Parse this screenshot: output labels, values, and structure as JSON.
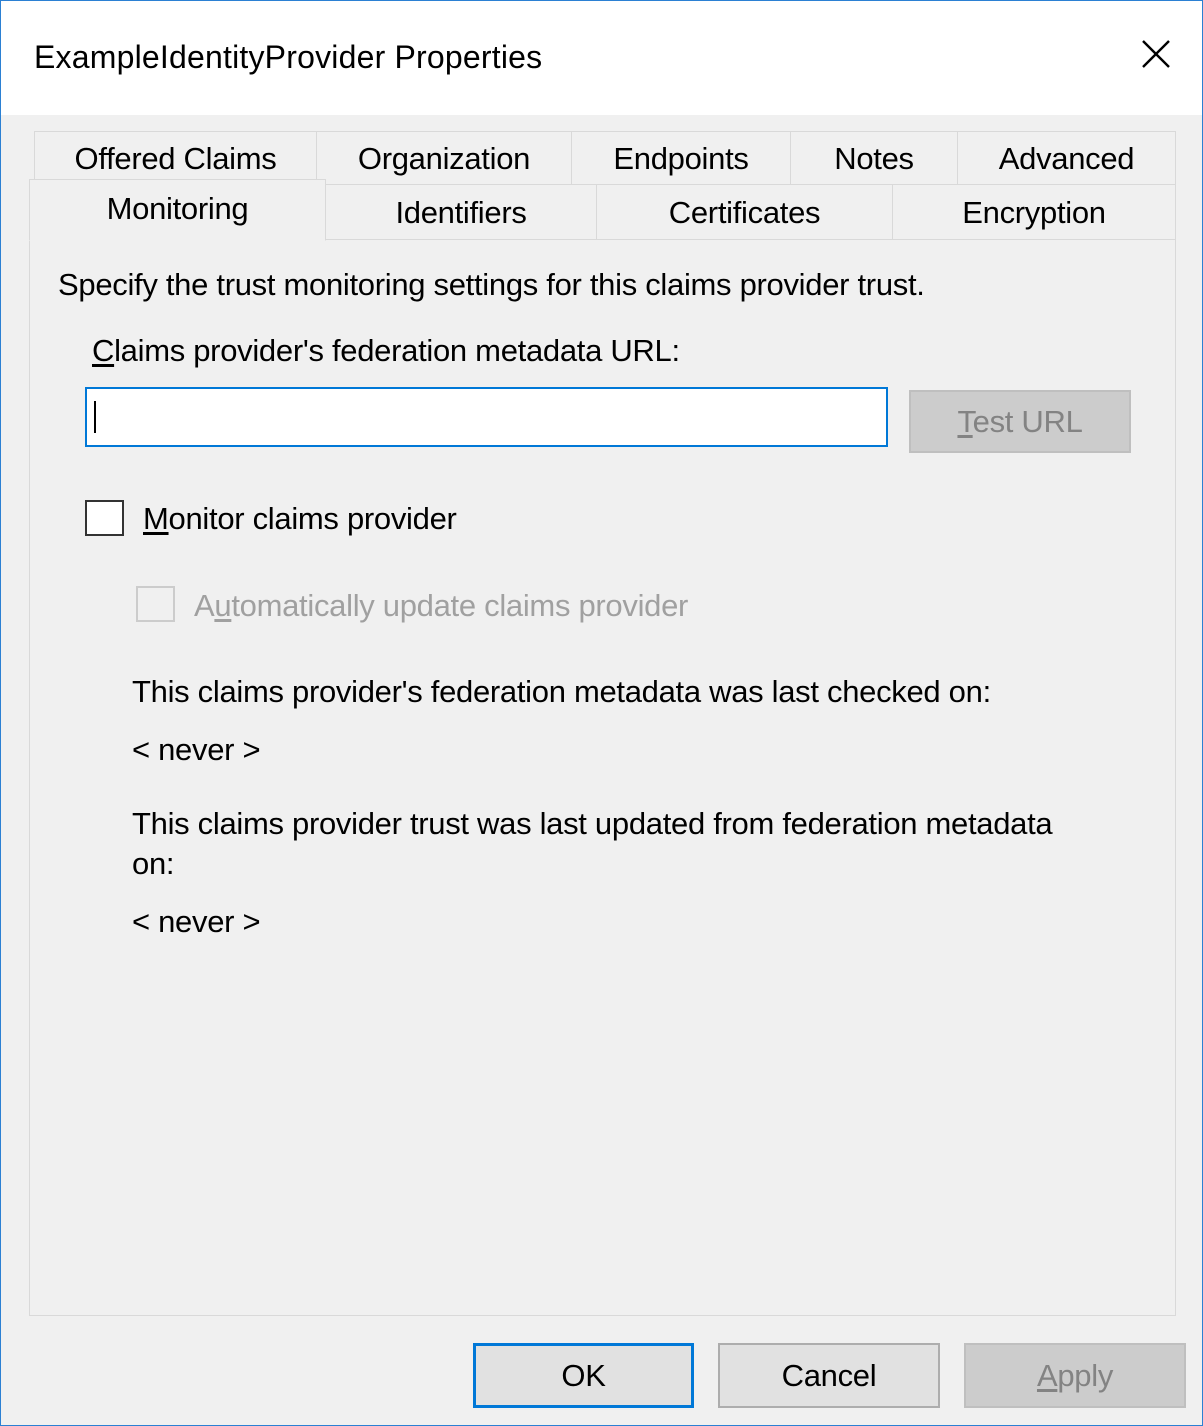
{
  "window": {
    "title": "ExampleIdentityProvider Properties",
    "close_icon": "close-icon",
    "accent_color": "#0078d7"
  },
  "tabs": {
    "row1": [
      {
        "label": "Offered Claims"
      },
      {
        "label": "Organization"
      },
      {
        "label": "Endpoints"
      },
      {
        "label": "Notes"
      },
      {
        "label": "Advanced"
      }
    ],
    "row2": [
      {
        "label": "Monitoring",
        "active": true
      },
      {
        "label": "Identifiers"
      },
      {
        "label": "Certificates"
      },
      {
        "label": "Encryption"
      }
    ]
  },
  "monitoring": {
    "description": "Specify the trust monitoring settings for this claims provider trust.",
    "url_label_mnemonic": "C",
    "url_label_rest": "laims provider's federation metadata URL:",
    "url_value": "",
    "test_url_mnemonic": "T",
    "test_url_rest": "est URL",
    "monitor_checkbox": {
      "mnemonic": "M",
      "rest": "onitor claims provider",
      "checked": false
    },
    "auto_update_checkbox": {
      "prefix": "A",
      "mnemonic": "u",
      "rest": "tomatically update claims provider",
      "checked": false,
      "enabled": false
    },
    "last_checked_label": "This claims provider's federation metadata was last checked on:",
    "last_checked_value": "< never >",
    "last_updated_label_line1": "This claims provider trust was last updated from federation metadata",
    "last_updated_label_line2": "on:",
    "last_updated_value": "< never >"
  },
  "buttons": {
    "ok": "OK",
    "cancel": "Cancel",
    "apply_mnemonic": "A",
    "apply_rest": "pply"
  }
}
